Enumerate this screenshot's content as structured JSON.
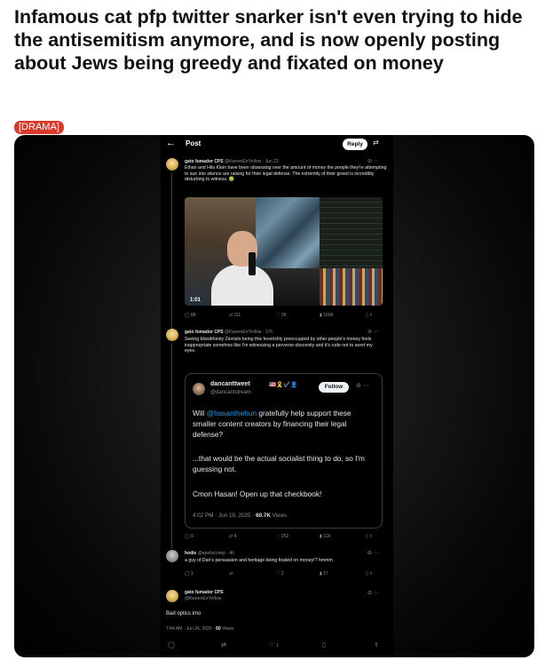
{
  "post": {
    "title": "Infamous cat pfp twitter snarker isn't even trying to hide the antisemitism anymore, and is now openly posting about Jews being greedy and fixated on money",
    "flair": "[DRAMA]"
  },
  "screenshot": {
    "header": {
      "back": "←",
      "title": "Post",
      "reply_label": "Reply",
      "adjust_icon": "⇄"
    },
    "tweet1": {
      "author": "gato fumador CPS",
      "meta": "@KweenErrYellow · Jun 23",
      "text": "Ethan and Hila Klein have been obsessing over the amount of money the people they're attempting to sue into silence are raising for their legal defense. The extremity of their greed is incredibly disturbing to witness. 🤢",
      "video_time": "1:01",
      "stats": {
        "replies": "88",
        "reposts": "111",
        "likes": "3K",
        "views": "166K"
      }
    },
    "tweet2": {
      "author": "gato fumador CPS",
      "meta": "@KweenErrYellow · 17h",
      "text": "Seeing bloodthirsty Zionists being this feverishly preoccupied by other people's money feels inappropriate somehow like I'm witnessing a perverse obscenity and it's rude not to avert my eyes.",
      "stats": {
        "replies": "9",
        "reposts": "4",
        "likes": "252",
        "views": "11K"
      }
    },
    "quote": {
      "author": "dancanttweet",
      "badges": "🇺🇸🎗️✔️👤",
      "handle": "@dancantstream",
      "follow_label": "Follow",
      "p1_before": "Will ",
      "p1_mention": "@hasanthehun",
      "p1_after": " gratefully help support these smaller content creators by financing their legal defense?",
      "p2": "...that would be the actual socialist thing to do, so I'm guessing not.",
      "p3": "Cmon Hasan! Open up that checkbook!",
      "meta_time": "4:02 PM · Jun 19, 2025 · ",
      "meta_views": "60.7K",
      "meta_views_label": " Views"
    },
    "reply": {
      "author": "hodie",
      "meta": "@apefuicreep · 4h",
      "text": "a guy of Dan's persuasion and heritage being fixated on money!? hmmm",
      "stats": {
        "replies": "1",
        "reposts": "",
        "likes": "2",
        "views": "17"
      }
    },
    "tweet3": {
      "author": "gato fumador CPS",
      "handle": "@KweenErrYellow",
      "text": "Bad optics imo",
      "meta_time": "7:44 AM · Jun 24, 2025 · ",
      "meta_views": "60",
      "meta_views_label": " Views",
      "likes": "1"
    }
  }
}
